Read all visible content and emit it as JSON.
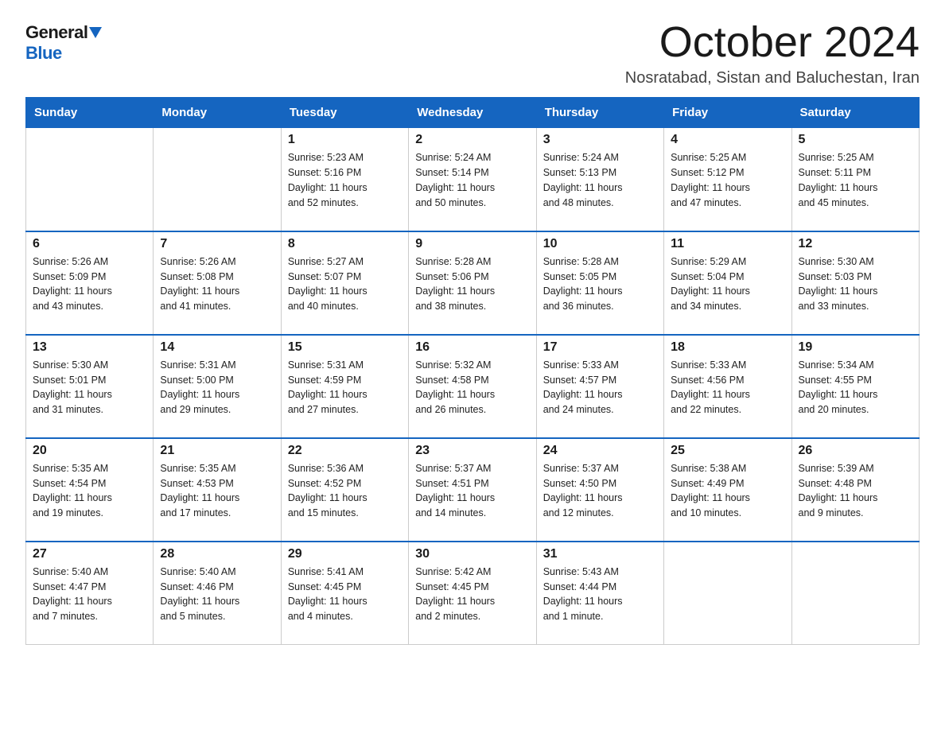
{
  "logo": {
    "general": "General",
    "blue": "Blue"
  },
  "header": {
    "month": "October 2024",
    "location": "Nosratabad, Sistan and Baluchestan, Iran"
  },
  "weekdays": [
    "Sunday",
    "Monday",
    "Tuesday",
    "Wednesday",
    "Thursday",
    "Friday",
    "Saturday"
  ],
  "weeks": [
    [
      {
        "day": "",
        "info": ""
      },
      {
        "day": "",
        "info": ""
      },
      {
        "day": "1",
        "info": "Sunrise: 5:23 AM\nSunset: 5:16 PM\nDaylight: 11 hours\nand 52 minutes."
      },
      {
        "day": "2",
        "info": "Sunrise: 5:24 AM\nSunset: 5:14 PM\nDaylight: 11 hours\nand 50 minutes."
      },
      {
        "day": "3",
        "info": "Sunrise: 5:24 AM\nSunset: 5:13 PM\nDaylight: 11 hours\nand 48 minutes."
      },
      {
        "day": "4",
        "info": "Sunrise: 5:25 AM\nSunset: 5:12 PM\nDaylight: 11 hours\nand 47 minutes."
      },
      {
        "day": "5",
        "info": "Sunrise: 5:25 AM\nSunset: 5:11 PM\nDaylight: 11 hours\nand 45 minutes."
      }
    ],
    [
      {
        "day": "6",
        "info": "Sunrise: 5:26 AM\nSunset: 5:09 PM\nDaylight: 11 hours\nand 43 minutes."
      },
      {
        "day": "7",
        "info": "Sunrise: 5:26 AM\nSunset: 5:08 PM\nDaylight: 11 hours\nand 41 minutes."
      },
      {
        "day": "8",
        "info": "Sunrise: 5:27 AM\nSunset: 5:07 PM\nDaylight: 11 hours\nand 40 minutes."
      },
      {
        "day": "9",
        "info": "Sunrise: 5:28 AM\nSunset: 5:06 PM\nDaylight: 11 hours\nand 38 minutes."
      },
      {
        "day": "10",
        "info": "Sunrise: 5:28 AM\nSunset: 5:05 PM\nDaylight: 11 hours\nand 36 minutes."
      },
      {
        "day": "11",
        "info": "Sunrise: 5:29 AM\nSunset: 5:04 PM\nDaylight: 11 hours\nand 34 minutes."
      },
      {
        "day": "12",
        "info": "Sunrise: 5:30 AM\nSunset: 5:03 PM\nDaylight: 11 hours\nand 33 minutes."
      }
    ],
    [
      {
        "day": "13",
        "info": "Sunrise: 5:30 AM\nSunset: 5:01 PM\nDaylight: 11 hours\nand 31 minutes."
      },
      {
        "day": "14",
        "info": "Sunrise: 5:31 AM\nSunset: 5:00 PM\nDaylight: 11 hours\nand 29 minutes."
      },
      {
        "day": "15",
        "info": "Sunrise: 5:31 AM\nSunset: 4:59 PM\nDaylight: 11 hours\nand 27 minutes."
      },
      {
        "day": "16",
        "info": "Sunrise: 5:32 AM\nSunset: 4:58 PM\nDaylight: 11 hours\nand 26 minutes."
      },
      {
        "day": "17",
        "info": "Sunrise: 5:33 AM\nSunset: 4:57 PM\nDaylight: 11 hours\nand 24 minutes."
      },
      {
        "day": "18",
        "info": "Sunrise: 5:33 AM\nSunset: 4:56 PM\nDaylight: 11 hours\nand 22 minutes."
      },
      {
        "day": "19",
        "info": "Sunrise: 5:34 AM\nSunset: 4:55 PM\nDaylight: 11 hours\nand 20 minutes."
      }
    ],
    [
      {
        "day": "20",
        "info": "Sunrise: 5:35 AM\nSunset: 4:54 PM\nDaylight: 11 hours\nand 19 minutes."
      },
      {
        "day": "21",
        "info": "Sunrise: 5:35 AM\nSunset: 4:53 PM\nDaylight: 11 hours\nand 17 minutes."
      },
      {
        "day": "22",
        "info": "Sunrise: 5:36 AM\nSunset: 4:52 PM\nDaylight: 11 hours\nand 15 minutes."
      },
      {
        "day": "23",
        "info": "Sunrise: 5:37 AM\nSunset: 4:51 PM\nDaylight: 11 hours\nand 14 minutes."
      },
      {
        "day": "24",
        "info": "Sunrise: 5:37 AM\nSunset: 4:50 PM\nDaylight: 11 hours\nand 12 minutes."
      },
      {
        "day": "25",
        "info": "Sunrise: 5:38 AM\nSunset: 4:49 PM\nDaylight: 11 hours\nand 10 minutes."
      },
      {
        "day": "26",
        "info": "Sunrise: 5:39 AM\nSunset: 4:48 PM\nDaylight: 11 hours\nand 9 minutes."
      }
    ],
    [
      {
        "day": "27",
        "info": "Sunrise: 5:40 AM\nSunset: 4:47 PM\nDaylight: 11 hours\nand 7 minutes."
      },
      {
        "day": "28",
        "info": "Sunrise: 5:40 AM\nSunset: 4:46 PM\nDaylight: 11 hours\nand 5 minutes."
      },
      {
        "day": "29",
        "info": "Sunrise: 5:41 AM\nSunset: 4:45 PM\nDaylight: 11 hours\nand 4 minutes."
      },
      {
        "day": "30",
        "info": "Sunrise: 5:42 AM\nSunset: 4:45 PM\nDaylight: 11 hours\nand 2 minutes."
      },
      {
        "day": "31",
        "info": "Sunrise: 5:43 AM\nSunset: 4:44 PM\nDaylight: 11 hours\nand 1 minute."
      },
      {
        "day": "",
        "info": ""
      },
      {
        "day": "",
        "info": ""
      }
    ]
  ]
}
